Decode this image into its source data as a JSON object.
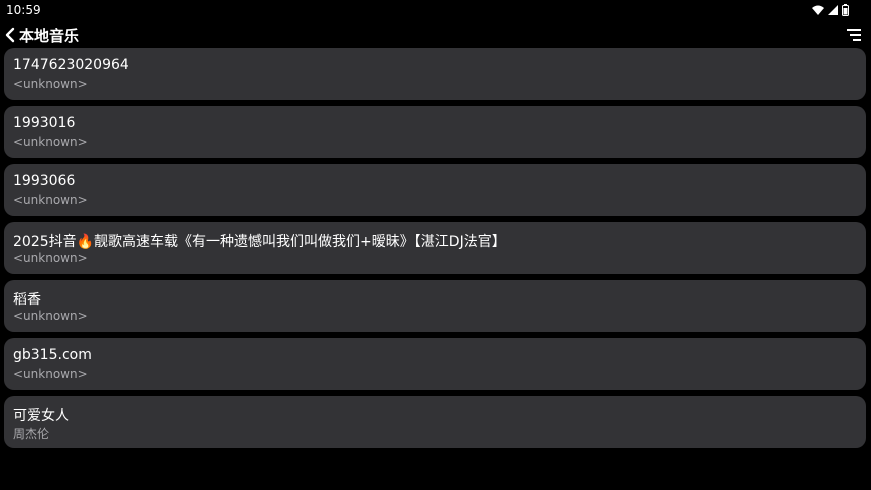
{
  "status_bar": {
    "time": "10:59",
    "icons": [
      "wifi-icon",
      "signal-icon",
      "battery-icon"
    ]
  },
  "app_bar": {
    "title": "本地音乐",
    "back_icon": "chevron-left-icon",
    "menu_icon": "sort-menu-icon"
  },
  "songs": [
    {
      "title": "1747623020964",
      "artist": "<unknown>"
    },
    {
      "title": "1993016",
      "artist": "<unknown>"
    },
    {
      "title": "1993066",
      "artist": "<unknown>"
    },
    {
      "title": "2025抖音🔥靓歌高速车载《有一种遗憾叫我们叫做我们+暧昧》【湛江DJ法官】",
      "artist": "<unknown>"
    },
    {
      "title": "稻香",
      "artist": "<unknown>"
    },
    {
      "title": "gb315.com",
      "artist": "<unknown>"
    },
    {
      "title": "可爱女人",
      "artist": "周杰伦"
    }
  ],
  "colors": {
    "background": "#000000",
    "card": "#333336",
    "primary_text": "#ffffff",
    "secondary_text": "#a9a9ad"
  }
}
